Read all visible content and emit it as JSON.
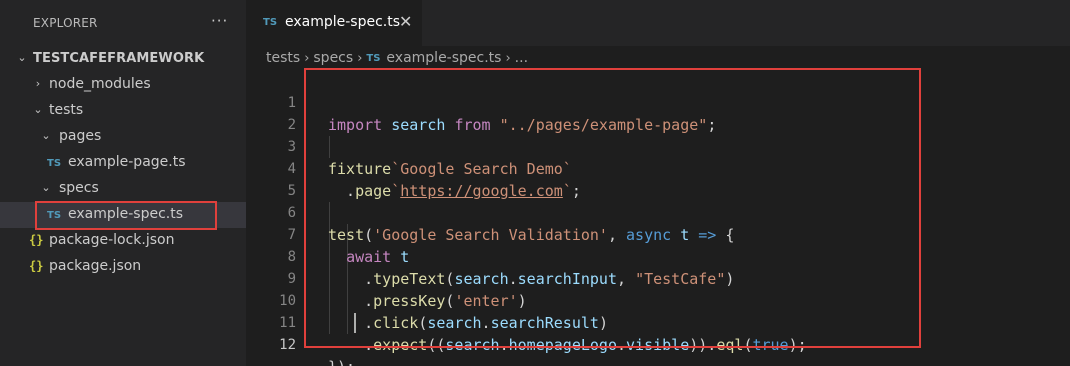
{
  "sidebar": {
    "title": "EXPLORER",
    "more_label": "···",
    "root": {
      "label": "TESTCAFEFRAMEWORK"
    },
    "items": [
      {
        "label": "node_modules",
        "type": "folder",
        "expanded": false
      },
      {
        "label": "tests",
        "type": "folder",
        "expanded": true
      },
      {
        "label": "pages",
        "type": "folder",
        "expanded": true
      },
      {
        "label": "example-page.ts",
        "type": "ts-file",
        "icon": "TS"
      },
      {
        "label": "specs",
        "type": "folder",
        "expanded": true
      },
      {
        "label": "example-spec.ts",
        "type": "ts-file",
        "icon": "TS",
        "selected": true
      },
      {
        "label": "package-lock.json",
        "type": "json-file",
        "icon": "{}"
      },
      {
        "label": "package.json",
        "type": "json-file",
        "icon": "{}"
      }
    ]
  },
  "tab": {
    "icon": "TS",
    "label": "example-spec.ts",
    "close": "✕"
  },
  "breadcrumb": {
    "parts": [
      "tests",
      "specs",
      "example-spec.ts",
      "..."
    ],
    "icon": "TS"
  },
  "editor": {
    "line_numbers": [
      "1",
      "2",
      "3",
      "4",
      "5",
      "6",
      "7",
      "8",
      "9",
      "10",
      "11",
      "12"
    ],
    "active_line": "12"
  },
  "colors": {
    "highlight_box": "#e0403c",
    "ts_icon": "#519aba",
    "json_icon": "#cbcb41"
  }
}
